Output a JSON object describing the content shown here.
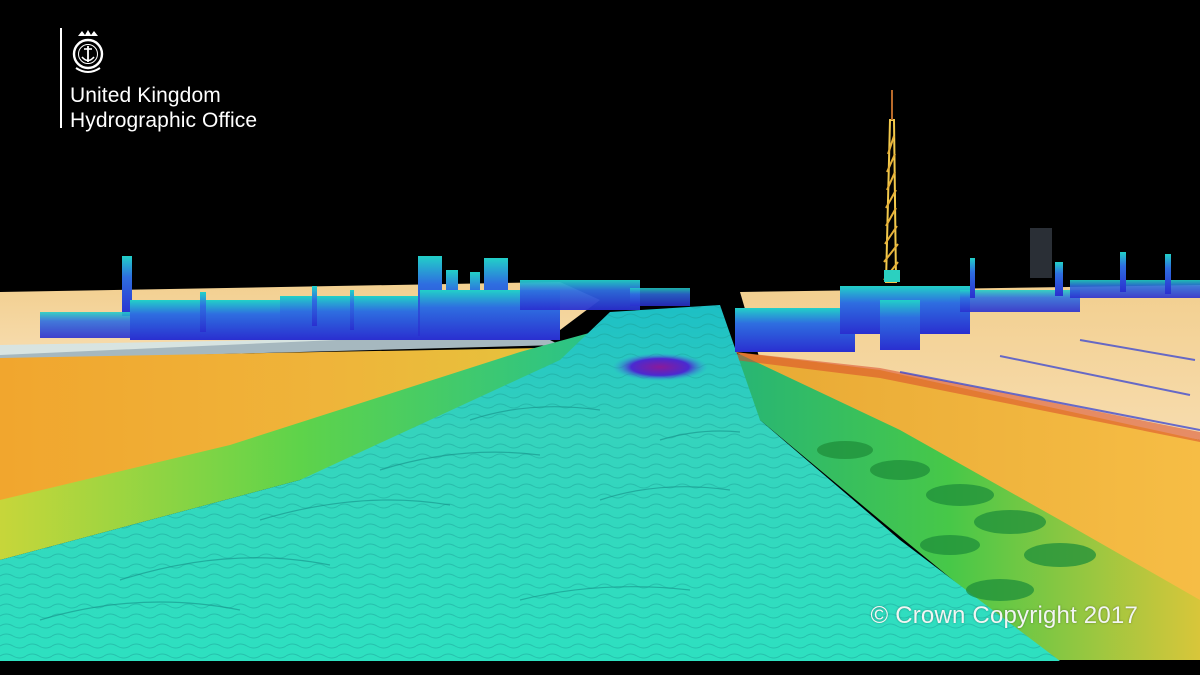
{
  "branding": {
    "line1": "United Kingdom",
    "line2": "Hydrographic Office"
  },
  "copyright": "© Crown Copyright 2017",
  "icons": {
    "crest": "crown-anchor-crest-icon"
  },
  "palette": {
    "background": "#000000",
    "channel": "#33d3b8",
    "seabed_bank": "#f0b23a",
    "structures": "#2b35d8",
    "tower": "#f2c94c"
  }
}
